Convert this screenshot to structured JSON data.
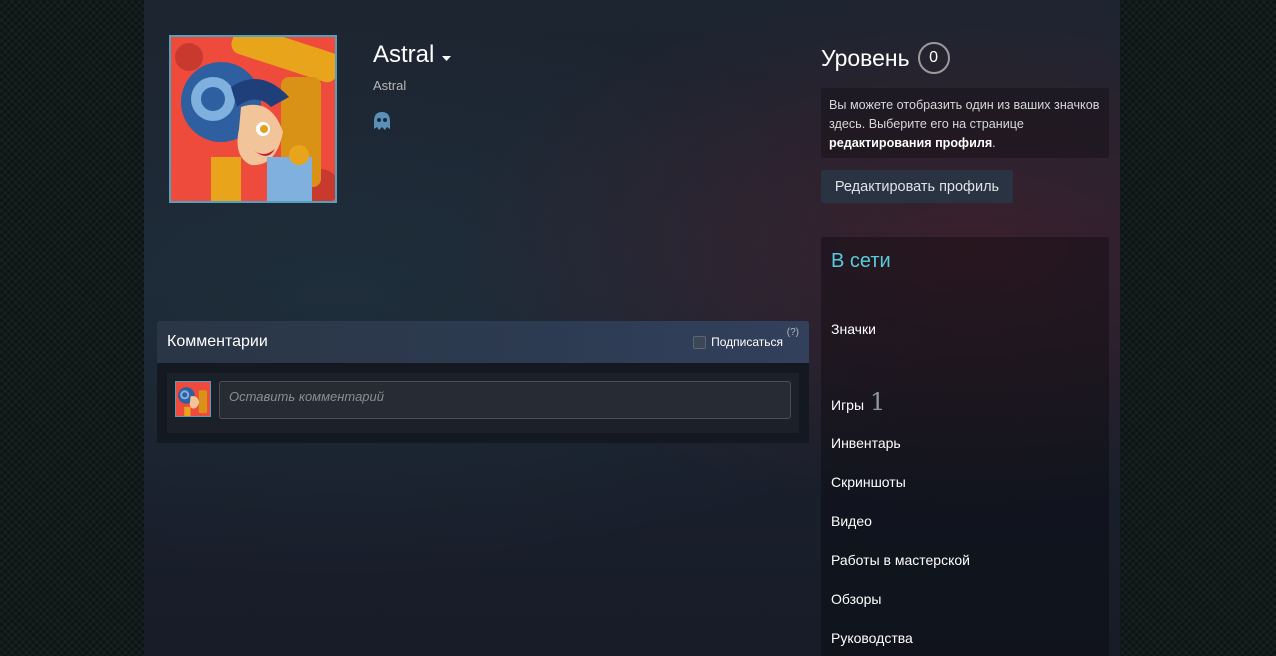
{
  "profile": {
    "persona_name": "Astral",
    "real_name": "Astral"
  },
  "level": {
    "label": "Уровень",
    "value": "0"
  },
  "badge_hint": {
    "text_before": "Вы можете отобразить один из ваших значков здесь. Выберите его на странице ",
    "link": "редактирования профиля",
    "text_after": "."
  },
  "edit_profile_button": "Редактировать профиль",
  "right_panel": {
    "status": "В сети",
    "badges": "Значки",
    "games": "Игры",
    "games_count": "1",
    "inventory": "Инвентарь",
    "screenshots": "Скриншоты",
    "videos": "Видео",
    "workshop": "Работы в мастерской",
    "reviews": "Обзоры",
    "guides": "Руководства"
  },
  "comments": {
    "title": "Комментарии",
    "subscribe": "Подписаться",
    "help": "(?)",
    "placeholder": "Оставить комментарий"
  },
  "colors": {
    "online": "#57cbde",
    "avatar_border": "#57a0bd",
    "avatar_bg": "#ee4b3c"
  }
}
